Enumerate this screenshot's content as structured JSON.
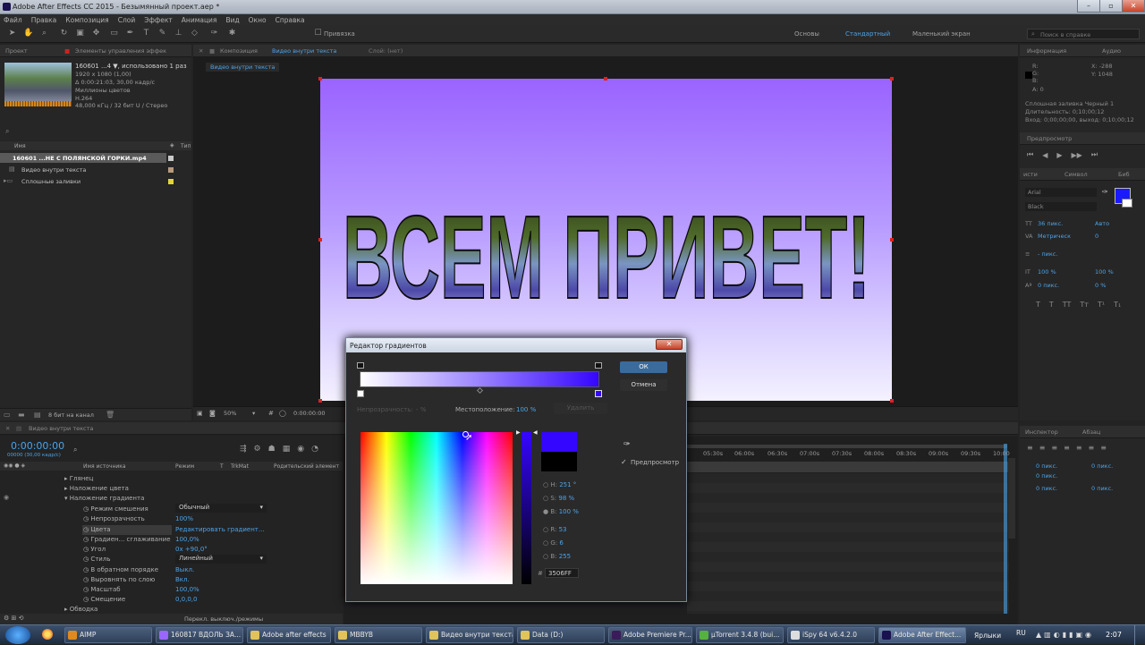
{
  "app": {
    "title": "Adobe After Effects CC 2015 - Безымянный проект.aep *"
  },
  "menu": [
    "Файл",
    "Правка",
    "Композиция",
    "Слой",
    "Эффект",
    "Анимация",
    "Вид",
    "Окно",
    "Справка"
  ],
  "toolbar": {
    "snap": "Привязка",
    "workspaces": [
      "Основы",
      "Стандартный",
      "Маленький экран"
    ],
    "search_placeholder": "Поиск в справке"
  },
  "project": {
    "tab1": "Проект",
    "tab2": "Элементы управления эффек",
    "file_name": "160601 ...4 ▼, использовано 1 раз",
    "file_info": [
      "1920 x 1080 (1,00)",
      "Δ 0:00:21:03, 30,00 кадр/с",
      "Миллионы цветов",
      "H.264",
      "48,000 кГц / 32 бит U / Стерео"
    ],
    "col_name": "Имя",
    "col_type": "Тип",
    "items": [
      "160601 ...НЕ С ПОЛЯНСКОЙ ГОРКИ.mp4",
      "Видео внутри текста",
      "Сплошные заливки"
    ],
    "bit_depth": "8 бит на канал"
  },
  "comp_panel": {
    "tab": "Композиция",
    "comp_name": "Видео внутри текста",
    "layer_tab": "Слой: (нет)",
    "breadcrumb": "Видео внутри текста",
    "zoom": "50%",
    "time": "0:00:00:00",
    "headline": "ВСЕМ ПРИВЕТ!"
  },
  "timeline": {
    "tab": "Видео внутри текста",
    "timecode": "0:00:00:00",
    "fps": "00000 (30,00 кадр/с)",
    "col_source": "Имя источника",
    "col_mode": "Режим",
    "col_t": "T",
    "col_trkmat": "TrkMat",
    "col_parent": "Родительский элемент",
    "groups": [
      "Глянец",
      "Наложение цвета",
      "Наложение градиента"
    ],
    "props": [
      {
        "name": "Режим смешения",
        "value": "Обычный"
      },
      {
        "name": "Непрозрачность",
        "value": "100%"
      },
      {
        "name": "Цвета",
        "value": "Редактировать градиент..."
      },
      {
        "name": "Градиен... сглаживание",
        "value": "100,0%"
      },
      {
        "name": "Угол",
        "value": "0x +90,0°"
      },
      {
        "name": "Стиль",
        "value": "Линейный"
      },
      {
        "name": "В обратном порядке",
        "value": "Выкл."
      },
      {
        "name": "Выровнять по слою",
        "value": "Вкл."
      },
      {
        "name": "Масштаб",
        "value": "100,0%"
      },
      {
        "name": "Смещение",
        "value": "0,0,0,0"
      }
    ],
    "stroke": "Обводка",
    "toggle": "Перекл. выключ./режимы",
    "ticks": [
      "05:30s",
      "06:00s",
      "06:30s",
      "07:00s",
      "07:30s",
      "08:00s",
      "08:30s",
      "09:00s",
      "09:30s",
      "10:00"
    ]
  },
  "gradient_editor": {
    "title": "Редактор градиентов",
    "ok": "ОК",
    "cancel": "Отмена",
    "opacity_label": "Непрозрачность:",
    "opacity_value": "- %",
    "location_label": "Местоположение:",
    "location_value": "100 %",
    "delete": "Удалить",
    "preview": "Предпросмотр",
    "H": "251 °",
    "S": "98 %",
    "B": "100 %",
    "R": "53",
    "G": "6",
    "Bv": "255",
    "hex": "3506FF",
    "color_new": "#3506FF",
    "color_old": "#000000"
  },
  "info_panel": {
    "tab": "Информация",
    "tab2": "Аудио",
    "R": "R:",
    "G": "G:",
    "B": "B:",
    "A": "A: 0",
    "X": "X: -288",
    "Y": "Y: 1048",
    "layer": "Сплошная заливка Черный 1",
    "dur": "Длительность: 0;10;00;12",
    "io": "Вход: 0;00;00;00, выход: 0;10;00;12"
  },
  "preview_panel": {
    "tab": "Предпросмотр"
  },
  "char_panel": {
    "tab1": "исти",
    "tab2": "Символ",
    "tab3": "Биб",
    "font": "Arial",
    "style": "Black",
    "size": "36 пикс.",
    "tracking": "Метрическ",
    "leading": "Авто",
    "kern": "0",
    "stroke": "- пикс.",
    "vscale": "100 %",
    "hscale": "100 %",
    "baseline": "0 пикс.",
    "tsume": "0 %",
    "fill": "#1a1aff"
  },
  "para_panel": {
    "tab1": "Инспектор",
    "tab2": "Абзац",
    "v1": "0 пикс.",
    "v2": "0 пикс.",
    "v3": "0 пикс.",
    "v4": "0 пикс.",
    "v5": "0 пикс."
  },
  "taskbar": {
    "items": [
      "AIMP",
      "160817 ВДОЛЬ ЗА...",
      "Adobe after effects",
      "MBBYB",
      "Видео внутри текста",
      "Data (D:)",
      "Adobe Premiere Pr...",
      "µTorrent 3.4.8 (bui...",
      "iSpy 64 v6.4.2.0",
      "Adobe After Effect..."
    ],
    "links": "Ярлыки",
    "lang": "RU",
    "clock": "2:07"
  }
}
